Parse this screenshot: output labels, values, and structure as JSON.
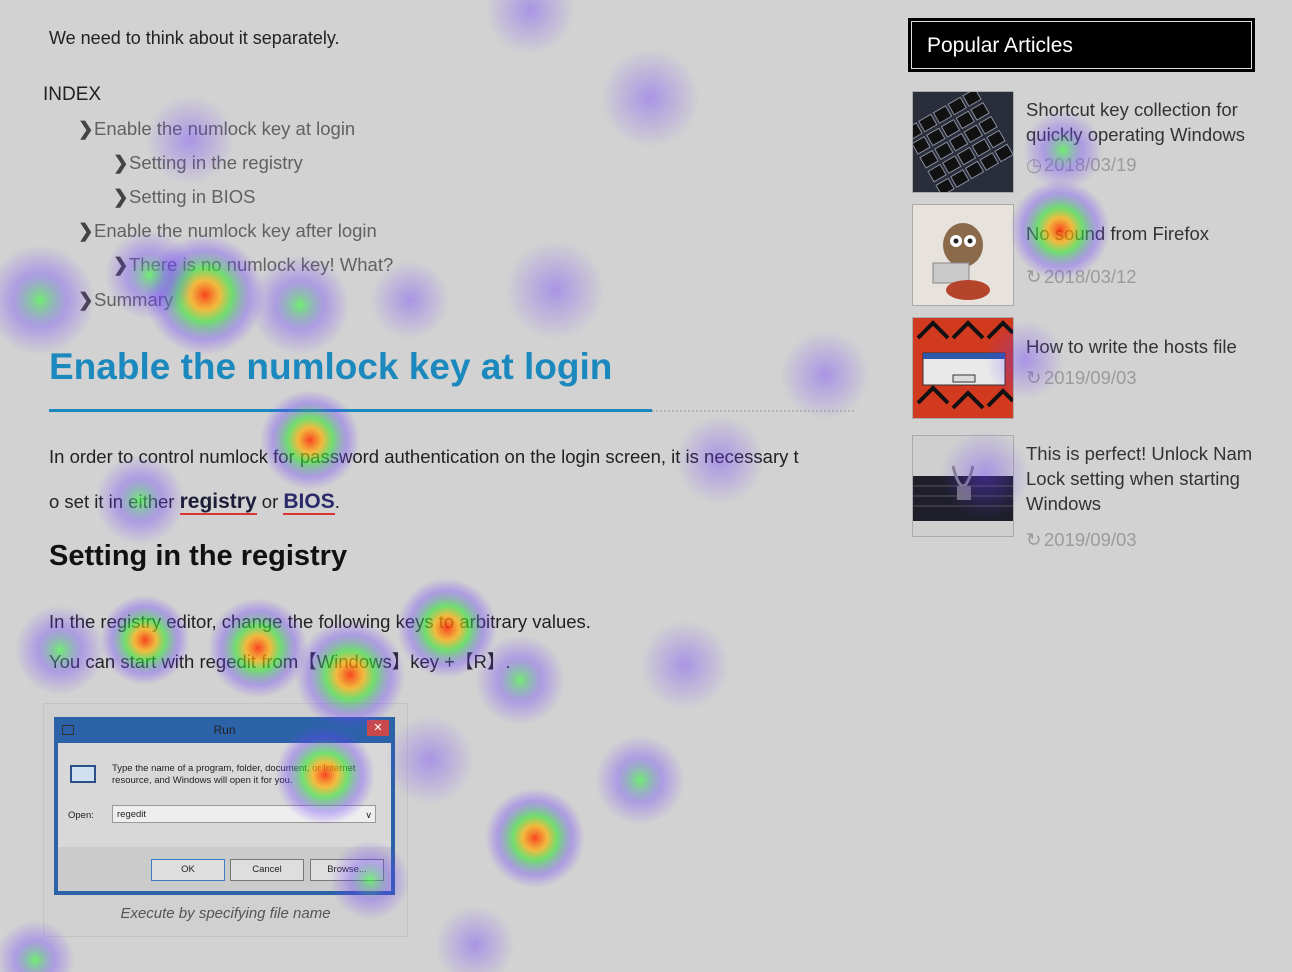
{
  "article": {
    "intro_text": "We need to think about it separately.",
    "index_title": "INDEX",
    "toc": [
      {
        "label": "Enable the numlock key at login",
        "level": 1
      },
      {
        "label": "Setting in the registry",
        "level": 2
      },
      {
        "label": "Setting in BIOS",
        "level": 2
      },
      {
        "label": "Enable the numlock key after login",
        "level": 1
      },
      {
        "label": "There is no numlock key! What?",
        "level": 2
      },
      {
        "label": "Summary",
        "level": 1
      }
    ],
    "heading1": "Enable the numlock key at login",
    "para1_line1": "In order to control numlock for password authentication on the login screen, it is necessary t",
    "para1_line2_pre": "o set it in either ",
    "para1_kw1": "registry",
    "para1_mid": " or ",
    "para1_kw2": "BIOS",
    "para1_end": ".",
    "heading2": "Setting in the registry",
    "para2_line1": "In the registry editor, change the following keys to arbitrary values.",
    "para2_line2": "You can start with regedit from【Windows】key +【R】.",
    "figure": {
      "caption": "Execute by specifying file name",
      "dialog_title": "Run",
      "dialog_close": "✕",
      "dialog_message": "Type the name of a program, folder, document, or Internet resource, and Windows will open it for you.",
      "open_label": "Open:",
      "input_value": "regedit",
      "ok_label": "OK",
      "cancel_label": "Cancel",
      "browse_label": "Browse..."
    }
  },
  "sidebar": {
    "header": "Popular Articles",
    "articles": [
      {
        "title": "Shortcut key collection for quickly operating Windows",
        "date": "2018/03/19",
        "date_icon": "clock-icon"
      },
      {
        "title": "No sound from Firefox",
        "date": "2018/03/12",
        "date_icon": "refresh-icon"
      },
      {
        "title": "How to write the hosts file",
        "date": "2019/09/03",
        "date_icon": "refresh-icon"
      },
      {
        "title": "This is perfect! Unlock Nam Lock setting when starting Windows",
        "date": "2019/09/03",
        "date_icon": "refresh-icon"
      }
    ]
  },
  "colors": {
    "heading_blue": "#1b89bd",
    "keyword_underline": "#dd3333",
    "background_gray": "#d2d2d2"
  }
}
